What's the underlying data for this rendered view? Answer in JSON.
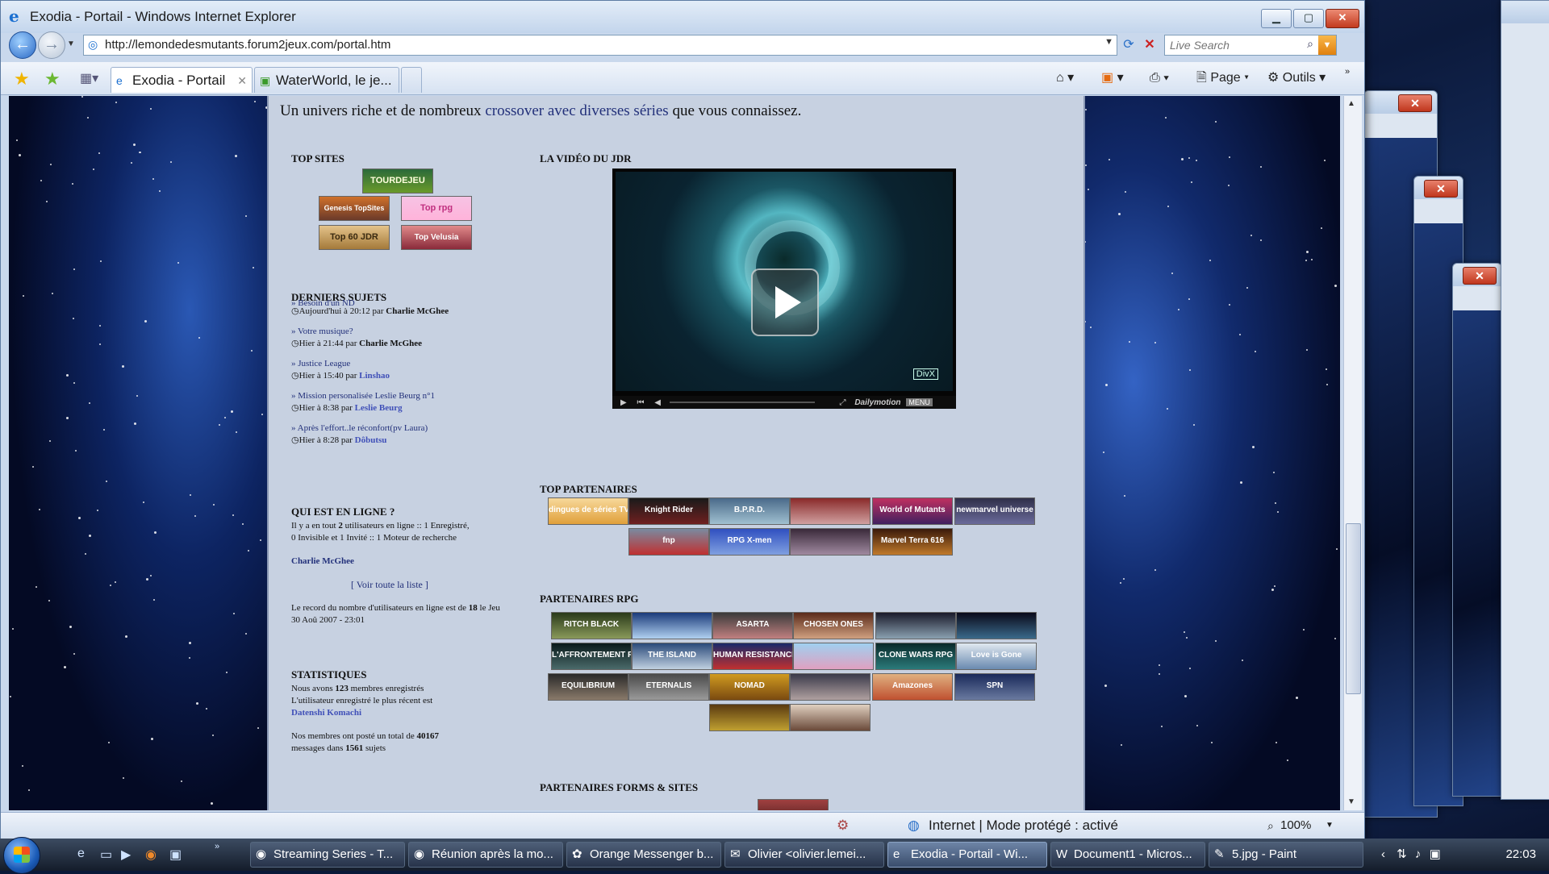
{
  "window": {
    "title": "Exodia - Portail - Windows Internet Explorer",
    "minimize": "▁",
    "maximize": "▢",
    "close": "✕"
  },
  "address": {
    "url": "http://lemondedesmutants.forum2jeux.com/portal.htm"
  },
  "search": {
    "placeholder": "Live Search"
  },
  "tabs": [
    {
      "label": "Exodia - Portail",
      "active": true
    },
    {
      "label": "WaterWorld, le je...",
      "active": false
    }
  ],
  "toolbar": {
    "page_label": "Page",
    "tools_label": "Outils"
  },
  "page": {
    "intro_prefix": "Un univers riche et de nombreux",
    "intro_link": "crossover avec diverses séries",
    "intro_suffix": "que vous connaissez.",
    "top_sites": {
      "heading": "TOP SITES",
      "banners": [
        "TOURDEJEU",
        "Genesis TopSites",
        "Top rpg",
        "Top 60 JDR",
        "Top Velusia"
      ]
    },
    "latest": {
      "heading": "DERNIERS SUJETS",
      "cut_title": "» Besoin d'un ND",
      "posts": [
        {
          "title": "» Votre musique?",
          "meta": "Hier à 21:44 par",
          "user": "Charlie McGhee",
          "blue": false
        },
        {
          "title": "» Justice League",
          "meta": "Hier à 15:40 par",
          "user": "Linshao",
          "blue": true
        },
        {
          "title": "» Mission personalisée Leslie Beurg n°1",
          "meta": "Hier à 8:38 par",
          "user": "Leslie Beurg",
          "blue": true
        },
        {
          "title": "» Après l'effort..le réconfort(pv Laura)",
          "meta": "Hier à 8:28 par",
          "user": "Dôbutsu",
          "blue": true
        }
      ],
      "first_meta": "Aujourd'hui à 20:12 par",
      "first_user": "Charlie McGhee"
    },
    "online": {
      "heading": "QUI EST EN LIGNE ?",
      "line1_pre": "Il y a en tout",
      "count": "2",
      "line1_post": "utilisateurs en ligne :: 1 Enregistré,",
      "line2": "0 Invisible et 1 Invité :: 1 Moteur de recherche",
      "user": "Charlie McGhee",
      "see_all": "Voir toute la liste",
      "record_pre": "Le record du nombre d'utilisateurs en ligne est de",
      "record_num": "18",
      "record_post": "le Jeu 30 Aoû 2007 - 23:01"
    },
    "stats": {
      "heading": "STATISTIQUES",
      "members_pre": "Nous avons",
      "members_num": "123",
      "members_post": "membres enregistrés",
      "latest_pre": "L'utilisateur enregistré le plus récent est",
      "latest_user": "Datenshi Komachi",
      "posts_pre": "Nos membres ont posté un total de",
      "posts_num": "40167",
      "posts_mid": "messages dans",
      "topics_num": "1561",
      "topics_post": "sujets"
    },
    "video": {
      "heading": "LA VIDÉO DU JDR",
      "brand": "Dailymotion",
      "menu": "MENU",
      "watermark": "DivX"
    },
    "partners": {
      "heading": "TOP PARTENAIRES",
      "banners": [
        "dingues de séries TV",
        "Knight Rider",
        "B.P.R.D.",
        "",
        "World of Mutants",
        "newmarvel universe",
        "fnp",
        "RPG X-men",
        "",
        "Marvel Terra 616"
      ]
    },
    "rpg": {
      "heading": "PARTENAIRES RPG",
      "banners": [
        "RITCH BLACK",
        "",
        "ASARTA",
        "CHOSEN ONES",
        "",
        "",
        "L'AFFRONTEMENT FINAL",
        "THE ISLAND",
        "HUMAN RESISTANCE",
        "",
        "CLONE WARS RPG",
        "Love is Gone",
        "EQUILIBRIUM",
        "ETERNALIS",
        "NOMAD",
        "",
        "Amazones",
        "SPN",
        "",
        ""
      ]
    },
    "forums": {
      "heading": "PARTENAIRES FORMS & SITES"
    }
  },
  "status": {
    "zone": "Internet | Mode protégé : activé",
    "zoom": "100%"
  },
  "taskbar": {
    "items": [
      {
        "label": "Streaming Series - T...",
        "active": false
      },
      {
        "label": "Réunion après la mo...",
        "active": false
      },
      {
        "label": "Orange Messenger b...",
        "active": false
      },
      {
        "label": "Olivier <olivier.lemei...",
        "active": false
      },
      {
        "label": "Exodia - Portail - Wi...",
        "active": true
      },
      {
        "label": "Document1 - Micros...",
        "active": false
      },
      {
        "label": "5.jpg - Paint",
        "active": false
      }
    ],
    "clock": "22:03"
  }
}
